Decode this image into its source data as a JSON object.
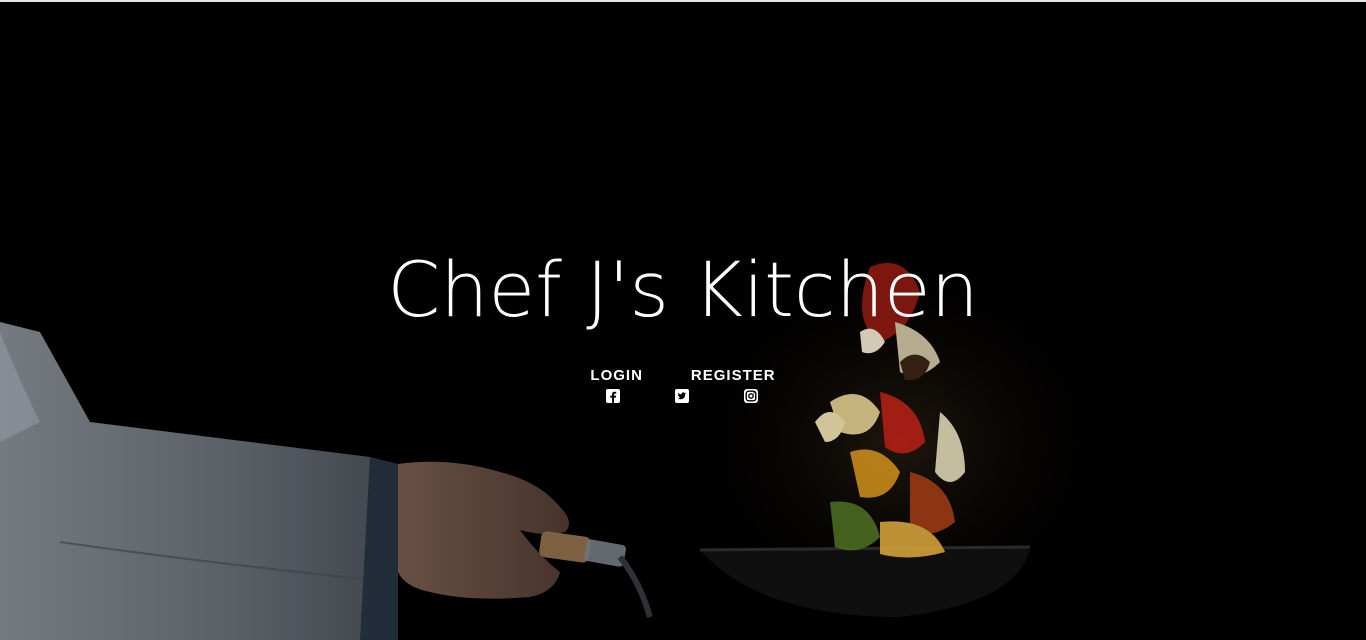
{
  "hero": {
    "title": "Chef J's Kitchen"
  },
  "nav": {
    "login_label": "LOGIN",
    "register_label": "REGISTER"
  },
  "social": {
    "icons": [
      "facebook-icon",
      "twitter-icon",
      "instagram-icon"
    ]
  },
  "colors": {
    "background": "#000000",
    "text": "#ffffff",
    "top_border": "#e6e6e6"
  }
}
